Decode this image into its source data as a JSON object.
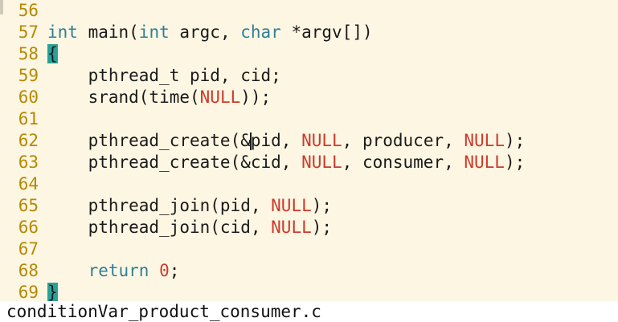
{
  "editor": {
    "lines": [
      {
        "num": "56",
        "parts": []
      },
      {
        "num": "57",
        "parts": [
          {
            "t": "int",
            "c": "ty"
          },
          {
            "t": " main("
          },
          {
            "t": "int",
            "c": "ty"
          },
          {
            "t": " argc, "
          },
          {
            "t": "char",
            "c": "ty"
          },
          {
            "t": " *argv[])"
          }
        ]
      },
      {
        "num": "58",
        "parts": [
          {
            "t": "{",
            "c": "bracket"
          }
        ]
      },
      {
        "num": "59",
        "parts": [
          {
            "t": "    pthread_t pid, cid;"
          }
        ]
      },
      {
        "num": "60",
        "parts": [
          {
            "t": "    srand(time("
          },
          {
            "t": "NULL",
            "c": "cst"
          },
          {
            "t": "));"
          }
        ]
      },
      {
        "num": "61",
        "parts": []
      },
      {
        "num": "62",
        "parts": [
          {
            "t": "    pthread_create(&"
          },
          {
            "cursor": true
          },
          {
            "t": "pid, "
          },
          {
            "t": "NULL",
            "c": "cst"
          },
          {
            "t": ", producer, "
          },
          {
            "t": "NULL",
            "c": "cst"
          },
          {
            "t": ");"
          }
        ]
      },
      {
        "num": "63",
        "parts": [
          {
            "t": "    pthread_create(&cid, "
          },
          {
            "t": "NULL",
            "c": "cst"
          },
          {
            "t": ", consumer, "
          },
          {
            "t": "NULL",
            "c": "cst"
          },
          {
            "t": ");"
          }
        ]
      },
      {
        "num": "64",
        "parts": []
      },
      {
        "num": "65",
        "parts": [
          {
            "t": "    pthread_join(pid, "
          },
          {
            "t": "NULL",
            "c": "cst"
          },
          {
            "t": ");"
          }
        ]
      },
      {
        "num": "66",
        "parts": [
          {
            "t": "    pthread_join(cid, "
          },
          {
            "t": "NULL",
            "c": "cst"
          },
          {
            "t": ");"
          }
        ]
      },
      {
        "num": "67",
        "parts": []
      },
      {
        "num": "68",
        "parts": [
          {
            "t": "    "
          },
          {
            "t": "return",
            "c": "kw"
          },
          {
            "t": " "
          },
          {
            "t": "0",
            "c": "cst"
          },
          {
            "t": ";"
          }
        ]
      },
      {
        "num": "69",
        "parts": [
          {
            "t": "}",
            "c": "bracket"
          }
        ]
      }
    ]
  },
  "status": {
    "filename": "conditionVar_product_consumer.c"
  },
  "colors": {
    "background": "#fdf6e3",
    "line_number": "#b58900",
    "type_keyword": "#2f7f97",
    "constant": "#cc3b2b",
    "bracket_highlight": "#2aa198",
    "statusbar": "#ffffff"
  }
}
